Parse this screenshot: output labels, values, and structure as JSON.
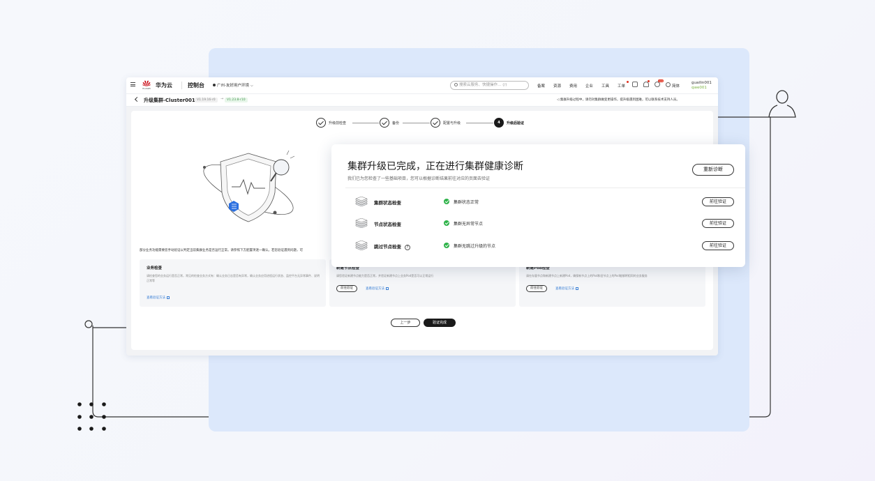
{
  "topbar": {
    "logo_name": "华为云",
    "logo_sub": "HUAWEI",
    "console_title": "控制台",
    "region": "广州-友好用户环境",
    "search_placeholder": "搜索云服务、快捷操作… (/)",
    "nav_links": [
      "备案",
      "资源",
      "费用",
      "企业",
      "工具",
      "工单"
    ],
    "lang_label": "简体",
    "user_name": "guailin001",
    "user_sub": "qwe001",
    "badge_text": "new"
  },
  "subbar": {
    "page_title": "升级集群-Cluster001",
    "version_from": "V1.19.16-r0",
    "arrow": "→",
    "version_to": "V1.23.8-r10",
    "notice": "集群升级过程中，请勿对集群做变更操作，提升级遇到困难，可以联系技术支持人员。"
  },
  "steps": [
    {
      "label": "升级前检查",
      "marker": ""
    },
    {
      "label": "备份",
      "marker": ""
    },
    {
      "label": "配置与升级",
      "marker": ""
    },
    {
      "label": "升级后验证",
      "marker": "4"
    }
  ],
  "warning_text": "部分业务功能需要您手动验证以判定当前集群业务是否运行正常。请参照下方配置项逐一确认。若您验证遇到问题，可",
  "info_boxes": [
    {
      "title": "业务检查",
      "desc": "请检查您的业务运行是否正常，常见的检查业务方式有：确认业务日志是否有异常，确认业务应用进程运行状态、监控平台无异常事件、说明正常等",
      "button": "",
      "link": "查看验证方法"
    },
    {
      "title": "新建节点检查",
      "desc": "请您验证新建节点能力是否正常，并验证新建节点上业务Pod是否可以正常运行",
      "button": "前往验证",
      "link": "查看验证方法"
    },
    {
      "title": "新建Pod检查",
      "desc": "请在存量节点和新建节点上新建Pod，确保新节点上的Pod和旧节点上的Pod能够将相同的业务服务",
      "button": "前往验证",
      "link": "查看验证方法"
    }
  ],
  "buttons": {
    "prev": "上一步",
    "done": "验证完成"
  },
  "dialog": {
    "title": "集群升级已完成，正在进行集群健康诊断",
    "subtitle": "我们已为您检查了一些基础项目，您可以根据诊断结果前往对应的页面去验证",
    "rediagnose": "重新诊断",
    "rows": [
      {
        "name": "集群状态检查",
        "status": "集群状态正常",
        "action": "前往验证",
        "help": ""
      },
      {
        "name": "节点状态检查",
        "status": "集群无异常节点",
        "action": "前往验证",
        "help": ""
      },
      {
        "name": "跳过节点检查",
        "status": "集群无跳过升级的节点",
        "action": "前往验证",
        "help": "?"
      }
    ]
  },
  "colors": {
    "panel_blue": "#dce8fb",
    "ok_green": "#2fb34a",
    "link_blue": "#3a7fd5",
    "shield_blue": "#2a6fe0"
  }
}
